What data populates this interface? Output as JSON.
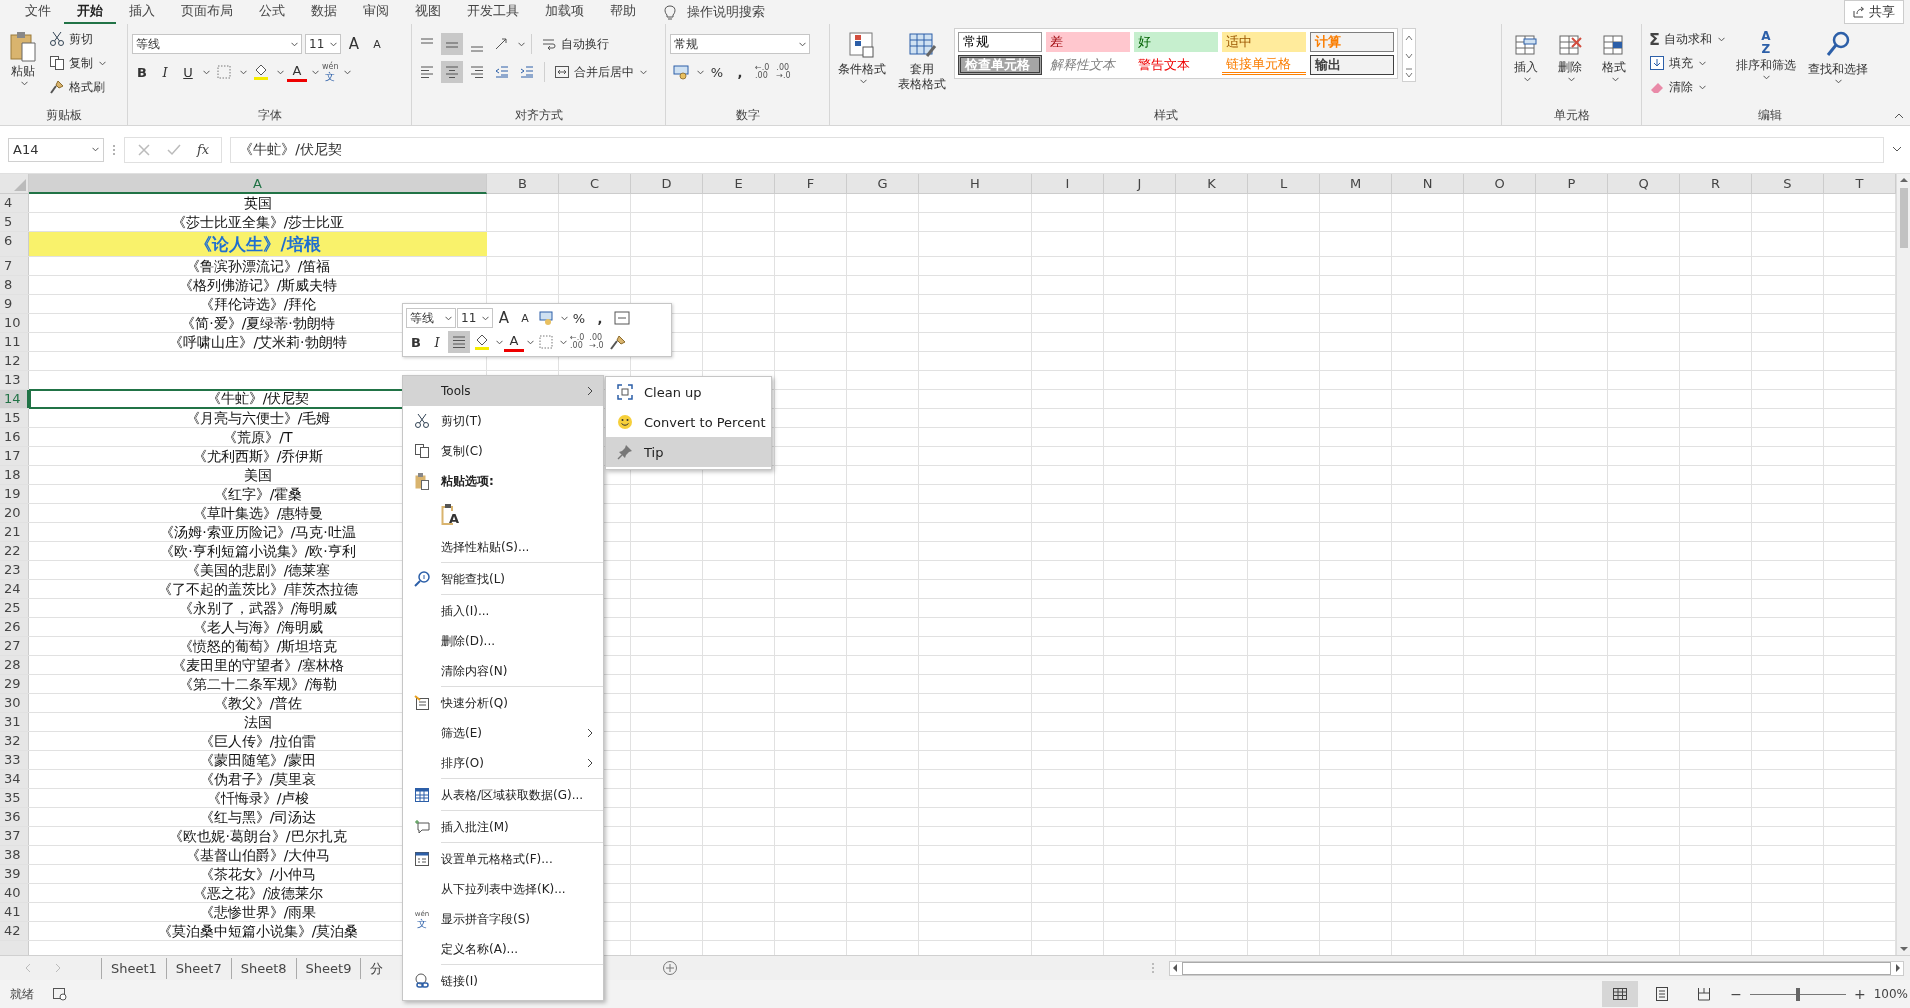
{
  "menu_bar": {
    "tabs": [
      {
        "label": "文件",
        "selected": false
      },
      {
        "label": "开始",
        "selected": true
      },
      {
        "label": "插入",
        "selected": false
      },
      {
        "label": "页面布局",
        "selected": false
      },
      {
        "label": "公式",
        "selected": false
      },
      {
        "label": "数据",
        "selected": false
      },
      {
        "label": "审阅",
        "selected": false
      },
      {
        "label": "视图",
        "selected": false
      },
      {
        "label": "开发工具",
        "selected": false
      },
      {
        "label": "加载项",
        "selected": false
      },
      {
        "label": "帮助",
        "selected": false
      }
    ],
    "tell_me": "操作说明搜索",
    "share_button": "共享"
  },
  "ribbon": {
    "clipboard": {
      "paste": "粘贴",
      "cut": "剪切",
      "copy": "复制",
      "format_painter": "格式刷",
      "label": "剪贴板"
    },
    "font": {
      "font_name": "等线",
      "font_size": "11",
      "grow": "A",
      "shrink": "A",
      "bold": "B",
      "italic": "I",
      "underline": "U",
      "font_color": "A",
      "phonetic_top": "wén",
      "phonetic_bottom": "文",
      "label": "字体"
    },
    "alignment": {
      "vertical_align": [
        {
          "selected": false
        },
        {
          "selected": true
        },
        {
          "selected": false
        }
      ],
      "horizontal_align": [
        {
          "selected": false
        },
        {
          "selected": true
        },
        {
          "selected": false
        }
      ],
      "wrap_text": "自动换行",
      "merge_center": "合并后居中",
      "label": "对齐方式"
    },
    "number": {
      "format": "常规",
      "percent": "%",
      "comma": ",",
      "increase_decimal": [
        "←.0",
        ".00"
      ],
      "decrease_decimal": [
        ".00",
        "→.0"
      ],
      "label": "数字"
    },
    "styles": {
      "conditional_formatting": "条件格式",
      "format_as_table": [
        "套用",
        "表格格式"
      ],
      "gallery": [
        {
          "label": "常规",
          "kind": "normal"
        },
        {
          "label": "差",
          "kind": "bad"
        },
        {
          "label": "好",
          "kind": "good"
        },
        {
          "label": "适中",
          "kind": "neutral"
        },
        {
          "label": "计算",
          "kind": "calculation"
        },
        {
          "label": "检查单元格",
          "kind": "check"
        },
        {
          "label": "解释性文本",
          "kind": "explanatory"
        },
        {
          "label": "警告文本",
          "kind": "warning"
        },
        {
          "label": "链接单元格",
          "kind": "linked"
        },
        {
          "label": "输出",
          "kind": "output"
        }
      ],
      "label": "样式"
    },
    "cells": {
      "buttons": [
        "插入",
        "删除",
        "格式"
      ],
      "label": "单元格"
    },
    "editing": {
      "sigma": "Σ",
      "autosum": "自动求和",
      "fill": "填充",
      "clear": "清除",
      "sort_glyph_top": "A",
      "sort_glyph_bottom": "Z",
      "sort_filter": "排序和筛选",
      "find_select": "查找和选择",
      "label": "编辑"
    }
  },
  "formula_bar": {
    "name_box": "A14",
    "fx": "fx",
    "formula": "《牛虻》/伏尼契"
  },
  "sheet": {
    "columns": [
      {
        "label": "A",
        "selected": true
      },
      {
        "label": "B",
        "selected": false
      },
      {
        "label": "C",
        "selected": false
      },
      {
        "label": "D",
        "selected": false
      },
      {
        "label": "E",
        "selected": false
      },
      {
        "label": "F",
        "selected": false
      },
      {
        "label": "G",
        "selected": false
      },
      {
        "label": "H",
        "selected": false
      },
      {
        "label": "I",
        "selected": false
      },
      {
        "label": "J",
        "selected": false
      },
      {
        "label": "K",
        "selected": false
      },
      {
        "label": "L",
        "selected": false
      },
      {
        "label": "M",
        "selected": false
      },
      {
        "label": "N",
        "selected": false
      },
      {
        "label": "O",
        "selected": false
      },
      {
        "label": "P",
        "selected": false
      },
      {
        "label": "Q",
        "selected": false
      },
      {
        "label": "R",
        "selected": false
      },
      {
        "label": "S",
        "selected": false
      },
      {
        "label": "T",
        "selected": false
      }
    ],
    "rows": [
      {
        "number": "4",
        "text": "英国",
        "highlighted": false,
        "selected": false
      },
      {
        "number": "5",
        "text": "《莎士比亚全集》/莎士比亚",
        "highlighted": false,
        "selected": false
      },
      {
        "number": "6",
        "text": "《论人生》/培根",
        "highlighted": true,
        "selected": false
      },
      {
        "number": "7",
        "text": "《鲁滨孙漂流记》/笛福",
        "highlighted": false,
        "selected": false
      },
      {
        "number": "8",
        "text": "《格列佛游记》/斯威夫特",
        "highlighted": false,
        "selected": false
      },
      {
        "number": "9",
        "text": "《拜伦诗选》/拜伦",
        "highlighted": false,
        "selected": false
      },
      {
        "number": "10",
        "text": "《简·爱》/夏绿蒂·勃朗特",
        "highlighted": false,
        "selected": false
      },
      {
        "number": "11",
        "text": "《呼啸山庄》/艾米莉·勃朗特",
        "highlighted": false,
        "selected": false
      },
      {
        "number": "12",
        "highlighted": false,
        "selected": false
      },
      {
        "number": "13",
        "highlighted": false,
        "selected": false
      },
      {
        "number": "14",
        "text": "《牛虻》/伏尼契",
        "highlighted": false,
        "selected": true
      },
      {
        "number": "15",
        "text": "《月亮与六便士》/毛姆",
        "highlighted": false,
        "selected": false
      },
      {
        "number": "16",
        "text": "《荒原》/T",
        "highlighted": false,
        "selected": false
      },
      {
        "number": "17",
        "text": "《尤利西斯》/乔伊斯",
        "highlighted": false,
        "selected": false
      },
      {
        "number": "18",
        "text": "美国",
        "highlighted": false,
        "selected": false
      },
      {
        "number": "19",
        "text": "《红字》/霍桑",
        "highlighted": false,
        "selected": false
      },
      {
        "number": "20",
        "text": "《草叶集选》/惠特曼",
        "highlighted": false,
        "selected": false
      },
      {
        "number": "21",
        "text": "《汤姆·索亚历险记》/马克·吐温",
        "highlighted": false,
        "selected": false
      },
      {
        "number": "22",
        "text": "《欧·亨利短篇小说集》/欧·亨利",
        "highlighted": false,
        "selected": false
      },
      {
        "number": "23",
        "text": "《美国的悲剧》/德莱塞",
        "highlighted": false,
        "selected": false
      },
      {
        "number": "24",
        "text": "《了不起的盖茨比》/菲茨杰拉德",
        "highlighted": false,
        "selected": false
      },
      {
        "number": "25",
        "text": "《永别了，武器》/海明威",
        "highlighted": false,
        "selected": false
      },
      {
        "number": "26",
        "text": "《老人与海》/海明威",
        "highlighted": false,
        "selected": false
      },
      {
        "number": "27",
        "text": "《愤怒的葡萄》/斯坦培克",
        "highlighted": false,
        "selected": false
      },
      {
        "number": "28",
        "text": "《麦田里的守望者》/塞林格",
        "highlighted": false,
        "selected": false
      },
      {
        "number": "29",
        "text": "《第二十二条军规》/海勒",
        "highlighted": false,
        "selected": false
      },
      {
        "number": "30",
        "text": "《教父》/普佐",
        "highlighted": false,
        "selected": false
      },
      {
        "number": "31",
        "text": "法国",
        "highlighted": false,
        "selected": false
      },
      {
        "number": "32",
        "text": "《巨人传》/拉伯雷",
        "highlighted": false,
        "selected": false
      },
      {
        "number": "33",
        "text": "《蒙田随笔》/蒙田",
        "highlighted": false,
        "selected": false
      },
      {
        "number": "34",
        "text": "《伪君子》/莫里哀",
        "highlighted": false,
        "selected": false
      },
      {
        "number": "35",
        "text": "《忏悔录》/卢梭",
        "highlighted": false,
        "selected": false
      },
      {
        "number": "36",
        "text": "《红与黑》/司汤达",
        "highlighted": false,
        "selected": false
      },
      {
        "number": "37",
        "text": "《欧也妮·葛朗台》/巴尔扎克",
        "highlighted": false,
        "selected": false
      },
      {
        "number": "38",
        "text": "《基督山伯爵》/大仲马",
        "highlighted": false,
        "selected": false
      },
      {
        "number": "39",
        "text": "《茶花女》/小仲马",
        "highlighted": false,
        "selected": false
      },
      {
        "number": "40",
        "text": "《恶之花》/波德莱尔",
        "highlighted": false,
        "selected": false
      },
      {
        "number": "41",
        "text": "《悲惨世界》/雨果",
        "highlighted": false,
        "selected": false
      },
      {
        "number": "42",
        "text": "《莫泊桑中短篇小说集》/莫泊桑",
        "highlighted": false,
        "selected": false
      }
    ]
  },
  "sheet_tabs": {
    "tabs": [
      {
        "label": "Sheet1",
        "selected": false
      },
      {
        "label": "Sheet7",
        "selected": false
      },
      {
        "label": "Sheet8",
        "selected": false
      },
      {
        "label": "Sheet9",
        "selected": false
      },
      {
        "label": "分",
        "selected": false
      }
    ]
  },
  "mini_toolbar": {
    "font_name": "等线",
    "font_size": "11",
    "grow": "A",
    "shrink": "A",
    "percent": "%",
    "comma": ",",
    "bold": "B",
    "italic": "I",
    "align_selected": true,
    "font_color": "A",
    "increase_decimal": [
      "←.0",
      ".00"
    ],
    "decrease_decimal": [
      ".00",
      "→.0"
    ]
  },
  "context_menu": {
    "sections": [
      [
        {
          "label": "Tools",
          "kind": "command",
          "submenu": true,
          "selected": true
        },
        {
          "label": "剪切(T)",
          "kind": "command",
          "submenu": false,
          "selected": false
        },
        {
          "label": "复制(C)",
          "kind": "command",
          "submenu": false,
          "selected": false
        },
        {
          "label": "粘贴选项:",
          "kind": "header"
        },
        {
          "label": "A",
          "kind": "paste-option"
        },
        {
          "label": "选择性粘贴(S)...",
          "kind": "command",
          "submenu": false,
          "selected": false
        }
      ],
      [
        {
          "label": "智能查找(L)",
          "kind": "command",
          "submenu": false,
          "selected": false
        }
      ],
      [
        {
          "label": "插入(I)...",
          "kind": "command",
          "submenu": false,
          "selected": false
        },
        {
          "label": "删除(D)...",
          "kind": "command",
          "submenu": false,
          "selected": false
        },
        {
          "label": "清除内容(N)",
          "kind": "command",
          "submenu": false,
          "selected": false
        }
      ],
      [
        {
          "label": "快速分析(Q)",
          "kind": "command",
          "submenu": false,
          "selected": false
        },
        {
          "label": "筛选(E)",
          "kind": "command",
          "submenu": true,
          "selected": false
        },
        {
          "label": "排序(O)",
          "kind": "command",
          "submenu": true,
          "selected": false
        }
      ],
      [
        {
          "label": "从表格/区域获取数据(G)...",
          "kind": "command",
          "submenu": false,
          "selected": false
        }
      ],
      [
        {
          "label": "插入批注(M)",
          "kind": "command",
          "submenu": false,
          "selected": false
        }
      ],
      [
        {
          "label": "设置单元格格式(F)...",
          "kind": "command",
          "submenu": false,
          "selected": false
        },
        {
          "label": "从下拉列表中选择(K)...",
          "kind": "command",
          "submenu": false,
          "selected": false
        },
        {
          "label": "显示拼音字段(S)",
          "kind": "command",
          "submenu": false,
          "selected": false,
          "glyph_top": "wén",
          "glyph_bottom": "文"
        },
        {
          "label": "定义名称(A)...",
          "kind": "command",
          "submenu": false,
          "selected": false
        }
      ],
      [
        {
          "label": "链接(I)",
          "kind": "command",
          "submenu": false,
          "selected": false
        }
      ]
    ],
    "submenu": [
      {
        "label": "Clean up",
        "selected": false
      },
      {
        "label": "Convert to Percent",
        "selected": false
      },
      {
        "label": "Tip",
        "selected": true
      }
    ]
  },
  "status_bar": {
    "status": "就绪",
    "views": [
      {
        "selected": true
      },
      {
        "selected": false
      },
      {
        "selected": false
      }
    ],
    "zoom_out": "−",
    "zoom_in": "+",
    "zoom": {
      "level": 0.5
    },
    "zoom_reading": "100%"
  }
}
